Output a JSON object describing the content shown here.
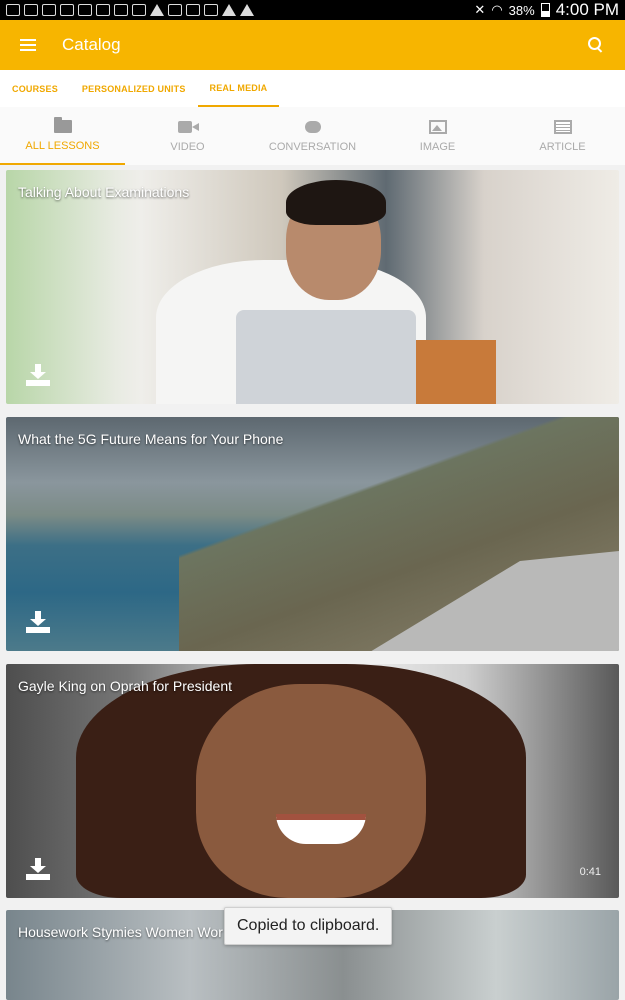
{
  "status_bar": {
    "battery": "38%",
    "time": "4:00 PM"
  },
  "app_bar": {
    "title": "Catalog"
  },
  "main_tabs": [
    {
      "label": "COURSES",
      "active": false
    },
    {
      "label": "PERSONALIZED UNITS",
      "active": false
    },
    {
      "label": "REAL MEDIA",
      "active": true
    }
  ],
  "filter_tabs": [
    {
      "label": "ALL LESSONS",
      "icon": "folder-icon",
      "active": true
    },
    {
      "label": "VIDEO",
      "icon": "video-camera-icon",
      "active": false
    },
    {
      "label": "CONVERSATION",
      "icon": "chat-icon",
      "active": false
    },
    {
      "label": "IMAGE",
      "icon": "image-icon",
      "active": false
    },
    {
      "label": "ARTICLE",
      "icon": "newspaper-icon",
      "active": false
    }
  ],
  "lessons": [
    {
      "title": "Talking About Examinations",
      "duration": ""
    },
    {
      "title": "What the 5G Future Means for Your Phone",
      "duration": ""
    },
    {
      "title": "Gayle King on Oprah for President",
      "duration": "0:41"
    },
    {
      "title": "Housework Stymies Women Wor",
      "duration": ""
    }
  ],
  "toast": {
    "message": "Copied to clipboard."
  },
  "colors": {
    "accent": "#f7b500",
    "tab_text": "#f0a800",
    "inactive": "#aaaaaa"
  }
}
